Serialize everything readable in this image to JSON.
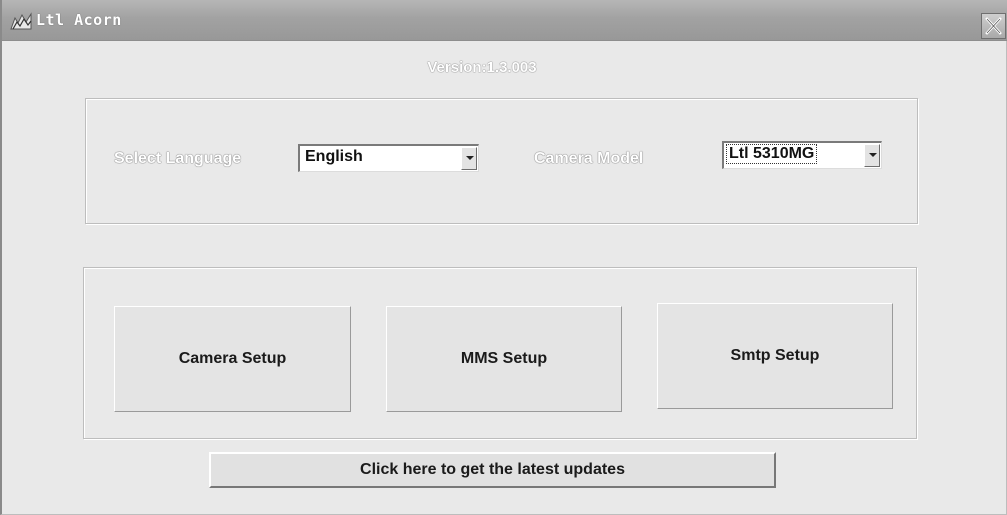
{
  "window": {
    "title": "Ltl Acorn",
    "icon": "app-logo-icon",
    "close_icon": "close-icon"
  },
  "version_text": "Version:1.3.003",
  "language": {
    "label": "Select Language",
    "selected": "English"
  },
  "camera": {
    "label": "Camera Model",
    "selected": "Ltl 5310MG"
  },
  "buttons": {
    "camera_setup": "Camera Setup",
    "mms_setup": "MMS Setup",
    "smtp_setup": "Smtp Setup"
  },
  "update_button": "Click here to get the latest updates"
}
